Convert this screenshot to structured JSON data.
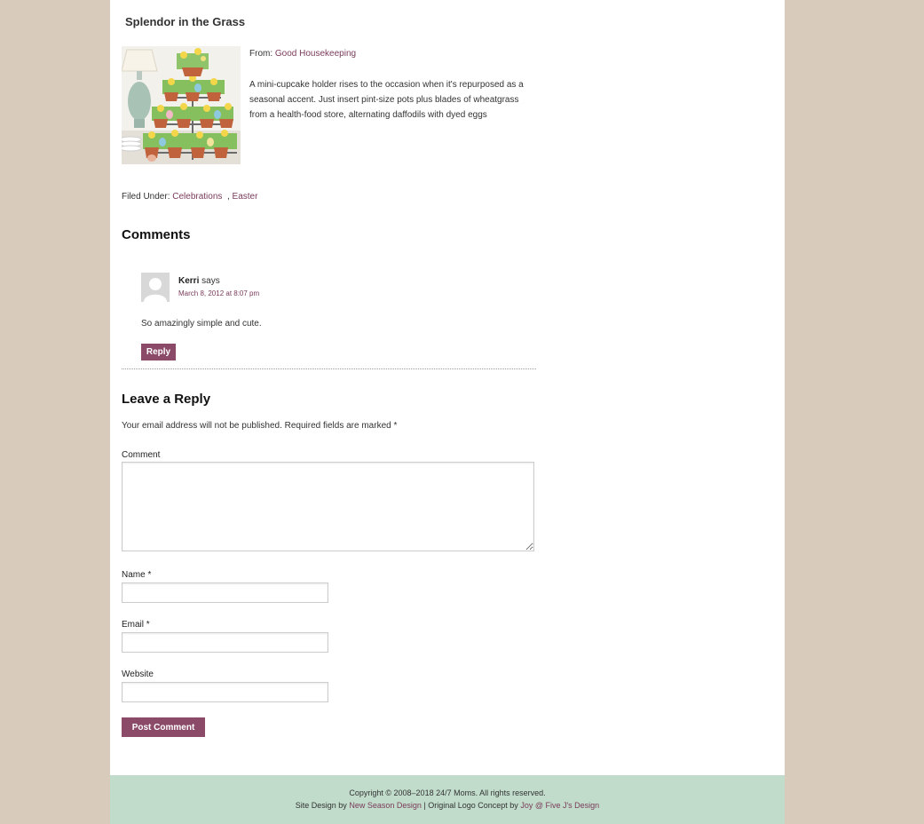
{
  "post": {
    "title": "Splendor in the Grass",
    "from_label": "From:",
    "from_source": "Good Housekeeping",
    "description": "A mini-cupcake holder rises to the occasion when it's repurposed as a seasonal accent. Just insert pint-size pots plus blades of wheatgrass from a health-food store, alternating daffodils with dyed eggs",
    "filed_label": "Filed Under:",
    "categories": [
      "Celebrations",
      "Easter"
    ]
  },
  "comments": {
    "heading": "Comments",
    "items": [
      {
        "author": "Kerri",
        "says": "says",
        "date": "March 8, 2012 at 8:07 pm",
        "text": "So amazingly simple and cute.",
        "reply_label": "Reply"
      }
    ]
  },
  "reply_form": {
    "heading": "Leave a Reply",
    "notice": "Your email address will not be published. Required fields are marked",
    "required_mark": "*",
    "comment_label": "Comment",
    "name_label": "Name",
    "email_label": "Email",
    "website_label": "Website",
    "comment_value": "",
    "name_value": "",
    "email_value": "",
    "website_value": "",
    "submit_label": "Post Comment"
  },
  "footer": {
    "copyright": "Copyright © 2008–2018 24/7 Moms. All rights reserved.",
    "site_design_label": "Site Design by",
    "site_design_link": "New Season Design",
    "logo_label": "| Original Logo Concept by",
    "logo_link": "Joy @ Five J's Design"
  },
  "colors": {
    "page_background": "#d9cbbb",
    "link": "#7a3b5a",
    "button": "#8a4a68",
    "footer_background": "#c1dccb"
  }
}
